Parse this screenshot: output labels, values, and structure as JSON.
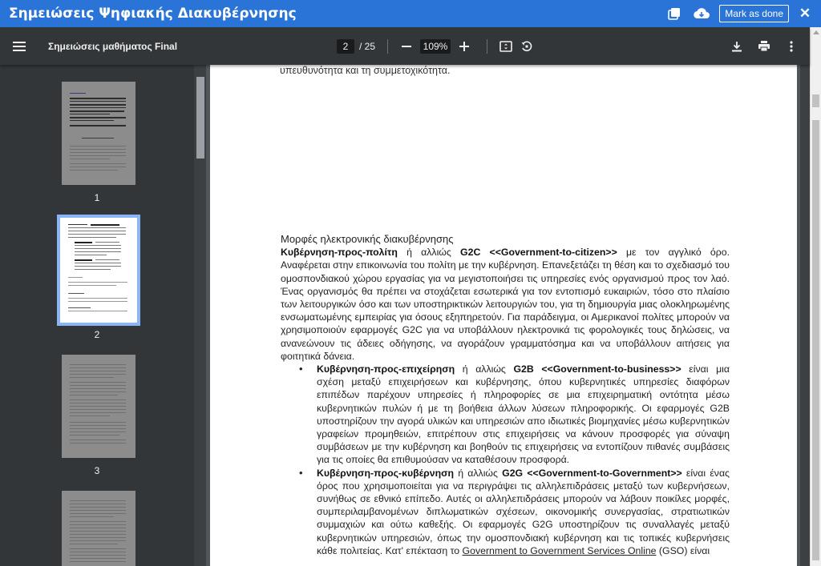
{
  "app": {
    "title": "Σημειώσεις Ψηφιακής Διακυβέρνησης",
    "mark_done_label": "Mark as done",
    "close_label": "✕"
  },
  "viewer": {
    "doc_title": "Σημειώσεις μαθήματος Final",
    "current_page": "2",
    "total_pages": "/ 25",
    "zoom": "109%"
  },
  "thumbnails": [
    {
      "label": "1"
    },
    {
      "label": "2"
    },
    {
      "label": "3"
    }
  ],
  "page1": {
    "tail_text": "υπευθυνότητα και τη συμμετοχικότητα."
  },
  "page2": {
    "heading": "Μορφές ηλεκτρονικής διακυβέρνησης",
    "intro_bold1": "Κυβέρνηση-προς-πολίτη",
    "intro_t1": " ή αλλιώς ",
    "intro_bold2": "G2C <<Government-to-citizen>>",
    "intro_t2": " με τον αγγλικό όρο. Αναφέρεται στην επικοινωνία του πολίτη με την κυβέρνηση. Επανεξετάζει τη θέση και το σχεδιασμό του ομοσπονδιακού χώρου εργασίας για να μεγιστοποιήσει τις υπηρεσίες ενός οργανισμού προς τον λαό. Ένας οργανισμός θα πρέπει να στοχάζεται εσωτερικά για τον εντοπισμό ευκαιριών, τόσο στο πλαίσιο των λειτουργικών όσο και των υποστηρικτικών λειτουργιών του, για τη δημιουργία μιας ολοκληρωμένης ενσωματωμένης εμπειρίας για όσους εξηπηρετούν. Για παράδειγμα, οι Αμερικανοί πολίτες μπορούν να χρησιμοποιούν εφαρμογές G2C για να υποβάλλουν ηλεκτρονικά τις φορολογικές τους δηλώσεις, να ανανεώνουν τις άδειες οδήγησης, να αγοράζουν γραμματόσημα και να υποβάλλουν αιτήσεις για φοιτητικά δάνεια.",
    "b1_bold1": "Κυβέρνηση-προς-επιχείρηση",
    "b1_t1": " ή αλλιώς ",
    "b1_bold2": "G2B <<Government-to-business>>",
    "b1_t2": " είναι μια σχέση μεταξύ επιχειρήσεων και κυβέρνησης, όπου κυβερνητικές υπηρεσίες διαφόρων επιπέδων παρέχουν υπηρεσίες ή πληροφορίες σε μια επιχειρηματική οντότητα μέσω κυβερνητικών πυλών ή με τη βοήθεια άλλων λύσεων πληροφορικής. Οι εφαρμογές G2B υποστηρίζουν την αγορά υλικών και υπηρεσιών απο ιδιωτικές βιομηχανίες μέσω κυβερνητικών γραφείων προμηθειών, επιτρέπουν στις επιχειρήσεις να κάνουν προσφορές για σύναψη συμβάσεων με την κυβέρνηση και βοηθούν τις επιχειρήσεις να εντοπίζουν πιθανές συμβάσεις για τις οποίες θα επιθυμούσαν να καταθέσουν προσφορά.",
    "b2_bold1": "Κυβέρνηση-προς-κυβέρνηση",
    "b2_t1": " ή αλλιώς ",
    "b2_bold2": "G2G <<Government-to-Government>>",
    "b2_t2": " είναι ένας όρος που χρησιμοποιείται για να περιγράψει τις αλληλεπιδράσεις μεταξύ των κυβερνήσεων, συνήθως σε εθνικό επίπεδο. Αυτές οι αλληλεπιδράσεις μπορούν να λάβουν ποικίλες μορφές, συμπεριλαμβανομένων διπλωματικών σχέσεων, οικονομικής συνεργασίας, στρατιωτικών συμμαχιών και ούτω καθεξής. Οι εφαρμογές G2G υποστηρίζουν τις συναλλαγές μεταξύ κυβερνητικών υπηρεσιών, όπως την ομοσπονδιακή κυβέρνηση και τις τοπικές κυβερνήσεις κάθε πολιτείας. Κατ' επέκταση το ",
    "b2_link": "Government to Government Services Online",
    "b2_t3": " (GSO) είναι"
  }
}
